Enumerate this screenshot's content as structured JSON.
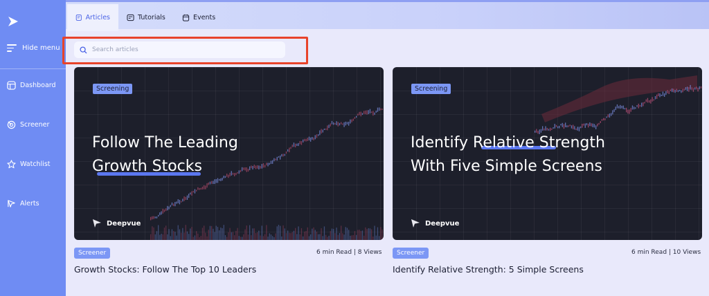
{
  "sidebar": {
    "hide_menu": "Hide menu",
    "items": [
      {
        "label": "Dashboard",
        "icon": "dashboard-icon"
      },
      {
        "label": "Screener",
        "icon": "screener-icon"
      },
      {
        "label": "Watchlist",
        "icon": "star-icon"
      },
      {
        "label": "Alerts",
        "icon": "alert-icon"
      }
    ]
  },
  "tabs": [
    {
      "label": "Articles",
      "icon": "articles-icon",
      "active": true
    },
    {
      "label": "Tutorials",
      "icon": "tutorials-icon",
      "active": false
    },
    {
      "label": "Events",
      "icon": "calendar-icon",
      "active": false
    }
  ],
  "search": {
    "placeholder": "Search articles",
    "value": ""
  },
  "articles": [
    {
      "image_badge": "Screening",
      "image_title_line1": "Follow The Leading",
      "image_title_line2": "Growth Stocks",
      "brand": "Deepvue",
      "category": "Screener",
      "meta": "6 min Read |  8 Views",
      "title": "Growth Stocks: Follow The Top 10 Leaders"
    },
    {
      "image_badge": "Screening",
      "image_title_line1": "Identify Relative Strength",
      "image_title_line2": "With Five Simple Screens",
      "brand": "Deepvue",
      "category": "Screener",
      "meta": "6 min Read |  10 Views",
      "title": "Identify Relative Strength: 5 Simple Screens"
    }
  ],
  "colors": {
    "sidebar": "#6f8cf3",
    "accent": "#4a63e6",
    "badge": "#7c97f5",
    "card_bg": "#1d1f2b",
    "highlight": "#e8432a"
  }
}
